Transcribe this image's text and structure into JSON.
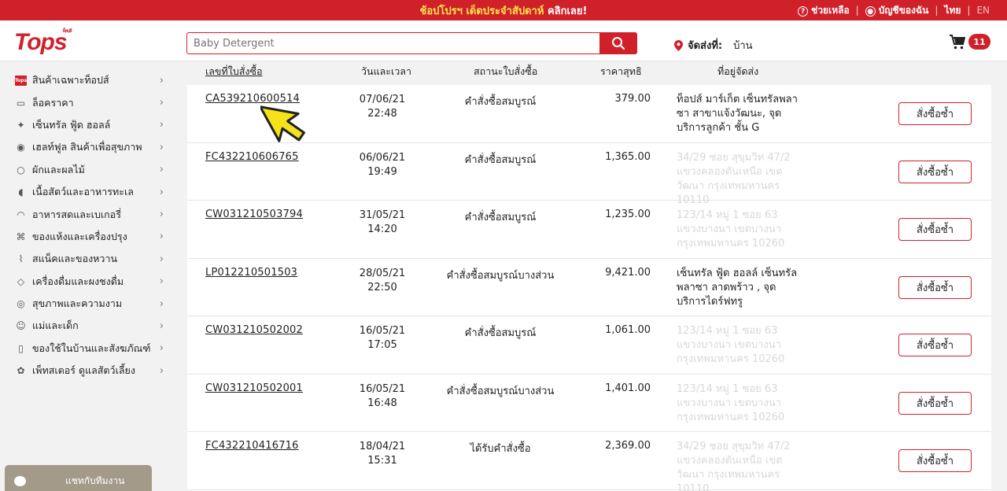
{
  "promo": {
    "text_white_prefix": "",
    "text_yellow": "ช้อปโปรฯ เด็ดประจำสัปดาห์",
    "text_white": "คลิกเลย!",
    "help": "ช่วยเหลือ",
    "account": "บัญชีของฉัน",
    "lang_th": "ไทย",
    "lang_en": "EN",
    "sep": "|"
  },
  "header": {
    "logo": "Tops",
    "logo_small": "ท็อปส์",
    "search_placeholder": "Baby Detergent",
    "deliver_label": "จัดส่งที่:",
    "deliver_value": "บ้าน",
    "cart_count": "11"
  },
  "sidebar": {
    "items": [
      {
        "label": "สินค้าเฉพาะท็อปส์",
        "icon": "tops-brand-icon"
      },
      {
        "label": "ล็อคราคา",
        "icon": "price-lock-icon"
      },
      {
        "label": "เซ็นทรัล ฟู้ด ฮอลล์",
        "icon": "food-hall-icon"
      },
      {
        "label": "เฮลท์ฟูล สินค้าเพื่อสุขภาพ",
        "icon": "healthy-icon"
      },
      {
        "label": "ผักและผลไม้",
        "icon": "fruit-icon"
      },
      {
        "label": "เนื้อสัตว์และอาหารทะเล",
        "icon": "meat-icon"
      },
      {
        "label": "อาหารสดและเบเกอรี่",
        "icon": "bakery-icon"
      },
      {
        "label": "ของแห้งและเครื่องปรุง",
        "icon": "grocery-icon"
      },
      {
        "label": "สแน็คและของหวาน",
        "icon": "snack-icon"
      },
      {
        "label": "เครื่องดื่มและผงชงดื่ม",
        "icon": "beverage-icon"
      },
      {
        "label": "สุขภาพและความงาม",
        "icon": "beauty-icon"
      },
      {
        "label": "แม่และเด็ก",
        "icon": "baby-icon"
      },
      {
        "label": "ของใช้ในบ้านและสังฆภัณฑ์",
        "icon": "household-icon"
      },
      {
        "label": "เพ็ทสเตอร์ ดูแลสัตว์เลี้ยง",
        "icon": "pet-icon"
      }
    ],
    "chat_label": "แชทกับทีมงาน"
  },
  "table": {
    "headers": {
      "order": "เลขที่ใบสั่งซื้อ",
      "date": "วันและเวลา",
      "status": "สถานะใบสั่งซื้อ",
      "price": "ราคาสุทธิ",
      "address": "ที่อยู่จัดส่ง"
    },
    "reorder_label": "สั่งซื้อซ้ำ",
    "rows": [
      {
        "order": "CA539210600514",
        "date": "07/06/21",
        "time": "22:48",
        "status": "คำสั่งซื้อสมบูรณ์",
        "price": "379.00",
        "address": "ท็อปส์ มาร์เก็ต เซ็นทรัลพลาซา สาขาแจ้งวัฒนะ, จุดบริการลูกค้า ชั้น G",
        "address_faded": false
      },
      {
        "order": "FC432210606765",
        "date": "06/06/21",
        "time": "19:49",
        "status": "คำสั่งซื้อสมบูรณ์",
        "price": "1,365.00",
        "address": "34/29 ซอย สุขุมวิท 47/2 แขวงคลองตันเหนือ เขตวัฒนา กรุงเทพมหานคร 10110",
        "address_faded": true
      },
      {
        "order": "CW031210503794",
        "date": "31/05/21",
        "time": "14:20",
        "status": "คำสั่งซื้อสมบูรณ์",
        "price": "1,235.00",
        "address": "123/14 หมู่ 1 ซอย 63 แขวงบางนา เขตบางนา กรุงเทพมหานคร 10260",
        "address_faded": true
      },
      {
        "order": "LP012210501503",
        "date": "28/05/21",
        "time": "22:50",
        "status": "คำสั่งซื้อสมบูรณ์บางส่วน",
        "price": "9,421.00",
        "address": "เซ็นทรัล ฟู้ด ฮอลล์ เซ็นทรัลพลาซา ลาดพร้าว , จุดบริการไดร์ฟทรู",
        "address_faded": false
      },
      {
        "order": "CW031210502002",
        "date": "16/05/21",
        "time": "17:05",
        "status": "คำสั่งซื้อสมบูรณ์",
        "price": "1,061.00",
        "address": "123/14 หมู่ 1 ซอย 63 แขวงบางนา เขตบางนา กรุงเทพมหานคร 10260",
        "address_faded": true
      },
      {
        "order": "CW031210502001",
        "date": "16/05/21",
        "time": "16:48",
        "status": "คำสั่งซื้อสมบูรณ์บางส่วน",
        "price": "1,401.00",
        "address": "123/14 หมู่ 1 ซอย 63 แขวงบางนา เขตบางนา กรุงเทพมหานคร 10260",
        "address_faded": true
      },
      {
        "order": "FC432210416716",
        "date": "18/04/21",
        "time": "15:31",
        "status": "ได้รับคำสั่งซื้อ",
        "price": "2,369.00",
        "address": "34/29 ซอย สุขุมวิท 47/2 แขวงคลองตันเหนือ เขตวัฒนา กรุงเทพมหานคร 10110",
        "address_faded": true
      }
    ]
  },
  "colors": {
    "brand_red": "#d0212b",
    "promo_yellow": "#ffe54c"
  }
}
